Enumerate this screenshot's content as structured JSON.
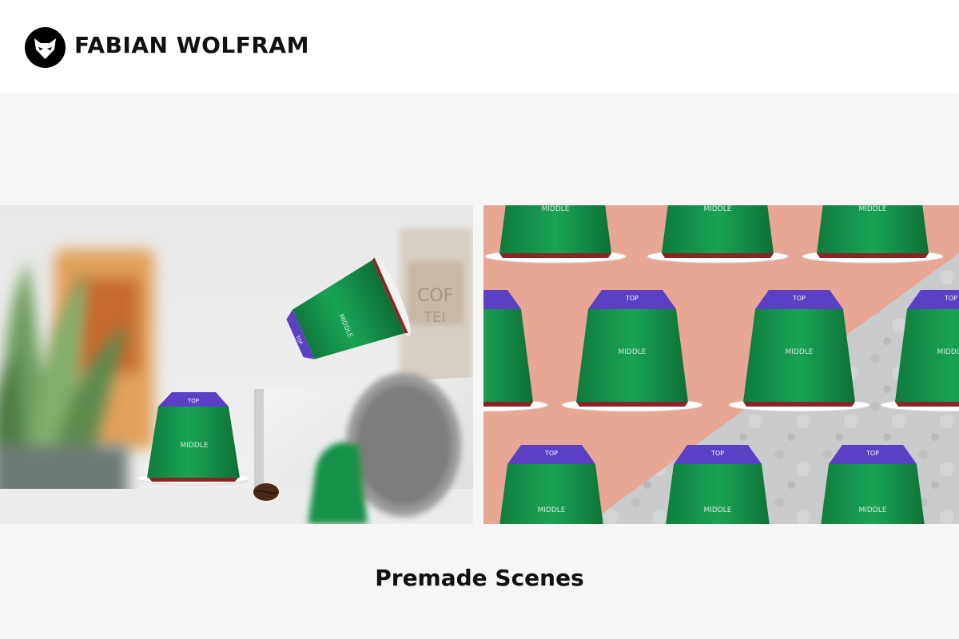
{
  "header": {
    "brand": "FABIAN WOLFRAM",
    "logo_icon": "fox-head-icon"
  },
  "scene_left": {
    "capsule_upright": {
      "top_label": "TOP",
      "middle_label": "MIDDLE"
    },
    "capsule_tilted": {
      "top_label": "TOP",
      "middle_label": "MIDDLE"
    },
    "background_text": {
      "line1": "COF",
      "line2": "TEI"
    }
  },
  "scene_right": {
    "top_label": "TOP",
    "middle_label": "MIDDLE"
  },
  "caption": "Premade Scenes",
  "colors": {
    "capsule_green": "#14914a",
    "capsule_purple": "#5b3fc4",
    "pink_background": "#e8a795",
    "concrete_background": "#c9cbcc"
  }
}
